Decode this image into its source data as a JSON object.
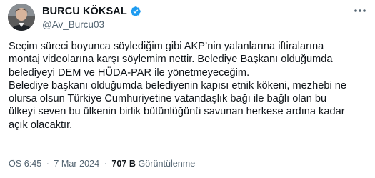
{
  "author": {
    "display_name": "BURCU KÖKSAL",
    "handle": "@Av_Burcu03",
    "verified_color": "#1d9bf0"
  },
  "tweet": {
    "text": "Seçim süreci boyunca söylediğim gibi AKP’nin yalanlarına iftiralarına\nmontaj videolarına karşı söylemim nettir. Belediye Başkanı olduğumda\nbelediyeyi DEM ve HÜDA-PAR ile yönetmeyeceğim.\nBelediye başkanı olduğumda belediyenin kapısı etnik kökeni, mezhebi ne\nolursa olsun Türkiye Cumhuriyetine vatandaşlık bağı ile bağlı olan bu\nülkeyi seven bu ülkenin birlik bütünlüğünü savunan herkese ardına kadar\naçık olacaktır."
  },
  "meta": {
    "time": "ÖS 6:45",
    "date": "7 Mar 2024",
    "views_count": "707 B",
    "views_label": "Görüntülenme",
    "separator": "·"
  },
  "icons": {
    "more": "more-options-icon",
    "verified": "verified-badge-icon"
  }
}
